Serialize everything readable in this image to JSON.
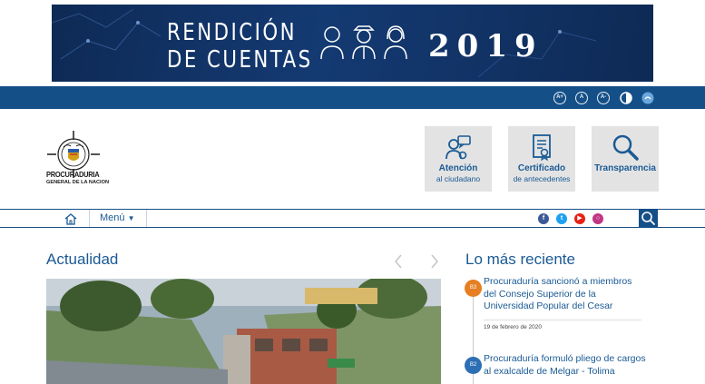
{
  "banner": {
    "line1": "RENDICIÓN",
    "line2": "DE CUENTAS",
    "year": "2019"
  },
  "accessibility": {
    "increase_label": "A+",
    "normal_label": "A",
    "decrease_label": "A-"
  },
  "logo": {
    "line1": "PROCURADURIA",
    "line2": "GENERAL DE LA NACION"
  },
  "quick_links": [
    {
      "title": "Atención",
      "subtitle": "al ciudadano",
      "icon": "citizen-chat-icon"
    },
    {
      "title": "Certificado",
      "subtitle": "de antecedentes",
      "icon": "certificate-icon"
    },
    {
      "title": "Transparencia",
      "subtitle": "",
      "icon": "magnifier-icon"
    }
  ],
  "nav": {
    "menu_label": "Menú"
  },
  "actualidad": {
    "title": "Actualidad"
  },
  "reciente": {
    "title": "Lo más reciente",
    "items": [
      {
        "badge": "B3",
        "text": "Procuraduría sancionó a miembros del Consejo Superior de la Universidad Popular del Cesar",
        "date": "19 de febrero de 2020",
        "color": "#e67e22"
      },
      {
        "badge": "B2",
        "text": "Procuraduría formuló pliego de cargos al exalcalde de Melgar - Tolima",
        "color": "#2d6fb4"
      }
    ]
  },
  "colors": {
    "brand_blue": "#154f87",
    "link_blue": "#1a5a94",
    "tile_gray": "#e3e3e3"
  }
}
